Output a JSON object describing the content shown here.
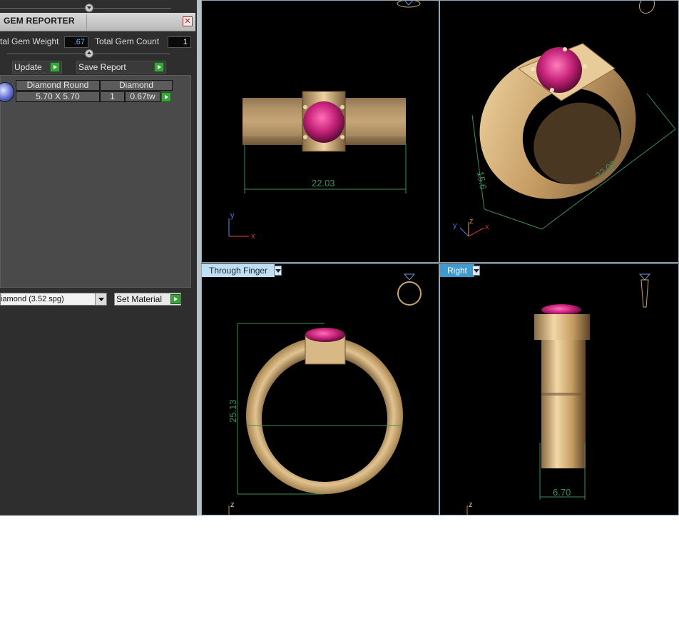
{
  "gem_reporter": {
    "title": "GEM REPORTER",
    "total_gem_weight_label": "tal Gem Weight",
    "total_gem_weight_value": ".67",
    "total_gem_count_label": "Total Gem Count",
    "total_gem_count_value": "1",
    "update_label": "Update",
    "save_report_label": "Save Report",
    "columns": [
      "Diamond Round",
      "Diamond"
    ],
    "row": {
      "size": "5.70 X 5.70",
      "count": "1",
      "weight": "0.67tw"
    },
    "material_value": "iamond    (3.52 spg)",
    "set_material_label": "Set Material"
  },
  "viewports": {
    "front": {
      "dimension": "22.03",
      "axis_y": "y",
      "axis_x": "x"
    },
    "perspective": {
      "dimension_width": "22.03",
      "dimension_height": "15.6",
      "axis_y": "y",
      "axis_z": "z",
      "axis_x": "x"
    },
    "through_finger": {
      "label": "Through Finger",
      "dimension": "25.13",
      "axis_z": "z"
    },
    "right": {
      "label": "Right",
      "dimension": "6.70",
      "axis_z": "z"
    }
  },
  "colors": {
    "gold": "#c9a46a",
    "ruby": "#c8247a",
    "dimension": "#3d8f5c",
    "viewport_border": "#8fa9b8",
    "active_label": "#3c9ad0"
  }
}
